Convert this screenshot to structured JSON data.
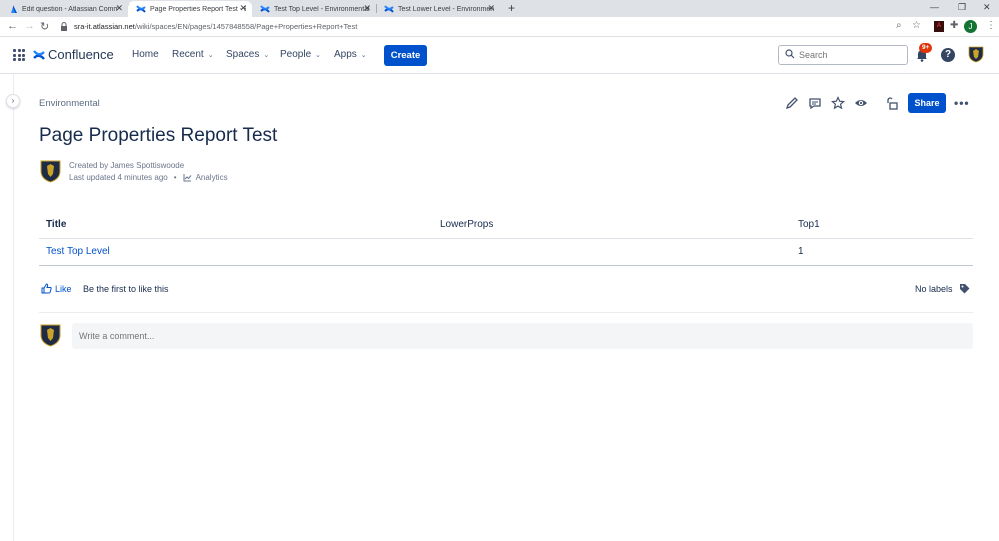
{
  "browser": {
    "tabs": [
      {
        "title": "Edit question - Atlassian Commu",
        "icon": "atlassian-icon",
        "active": false
      },
      {
        "title": "Page Properties Report Test - En",
        "icon": "confluence-icon",
        "active": true
      },
      {
        "title": "Test Top Level - Environmental -",
        "icon": "confluence-icon",
        "active": false
      },
      {
        "title": "Test Lower Level - Environmental",
        "icon": "confluence-icon",
        "active": false
      }
    ],
    "url_host": "sra-it.atlassian.net",
    "url_path": "/wiki/spaces/EN/pages/1457848558/Page+Properties+Report+Test",
    "profile_initial": "J"
  },
  "header": {
    "product": "Confluence",
    "nav": [
      "Home",
      "Recent",
      "Spaces",
      "People",
      "Apps"
    ],
    "create_label": "Create",
    "search_placeholder": "Search",
    "notifications_badge": "9+",
    "help_label": "?"
  },
  "page": {
    "breadcrumb": "Environmental",
    "share_label": "Share",
    "more_label": "•••",
    "title": "Page Properties Report Test",
    "created_by": "Created by James Spottiswoode",
    "last_updated": "Last updated 4 minutes ago",
    "analytics_label": "Analytics",
    "table": {
      "headers": [
        "Title",
        "LowerProps",
        "Top1"
      ],
      "rows": [
        {
          "title": "Test Top Level",
          "lower": "",
          "top1": "1"
        }
      ]
    },
    "like_label": "Like",
    "like_prompt": "Be the first to like this",
    "labels_text": "No labels",
    "comment_placeholder": "Write a comment..."
  },
  "colors": {
    "primary": "#0052cc",
    "text": "#172b4d",
    "subtle": "#6b778c",
    "badge": "#de350b"
  }
}
